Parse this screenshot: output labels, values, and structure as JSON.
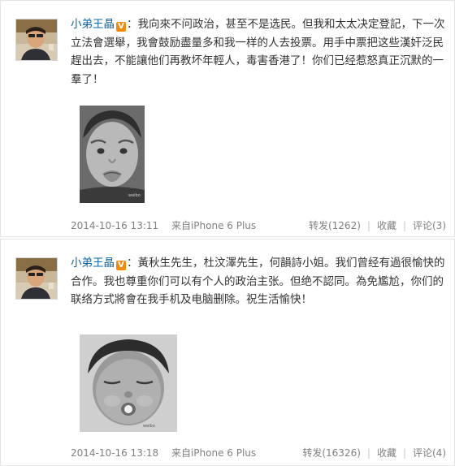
{
  "posts": [
    {
      "author": "小弟王晶",
      "badge": "V",
      "text": "：我向來不问政治，甚至不是选民。但我和太太决定登記，下一次立法會選舉，我會鼓励盡量多和我一样的人去投票。用手中票把这些漢奸泛民趕出去，不能讓他们再教坏年輕人，毒害香港了！你们已经惹怒真正沉默的一羣了！",
      "photo_icon": "child-pouting-photo",
      "time": "2014-10-16 13:11",
      "source": "来自iPhone 6 Plus",
      "repost": "转发(1262)",
      "favorite": "收藏",
      "comment": "评论(3)"
    },
    {
      "author": "小弟王晶",
      "badge": "V",
      "text": "：黃秋生先生，杜汶澤先生，何韻詩小姐。我们曾经有過很愉快的合作。我也尊重你们可以有个人的政治主张。但绝不認同。為免尷尬，你们的联络方式將會在我手机及电脑删除。祝生活愉快！",
      "photo_icon": "child-sleeping-photo",
      "time": "2014-10-16 13:18",
      "source": "来自iPhone 6 Plus",
      "repost": "转发(16326)",
      "favorite": "收藏",
      "comment": "评论(4)"
    }
  ],
  "colors": {
    "author_link": "#0a64a6",
    "meta_text": "#808080",
    "badge": "#f28a0e"
  }
}
